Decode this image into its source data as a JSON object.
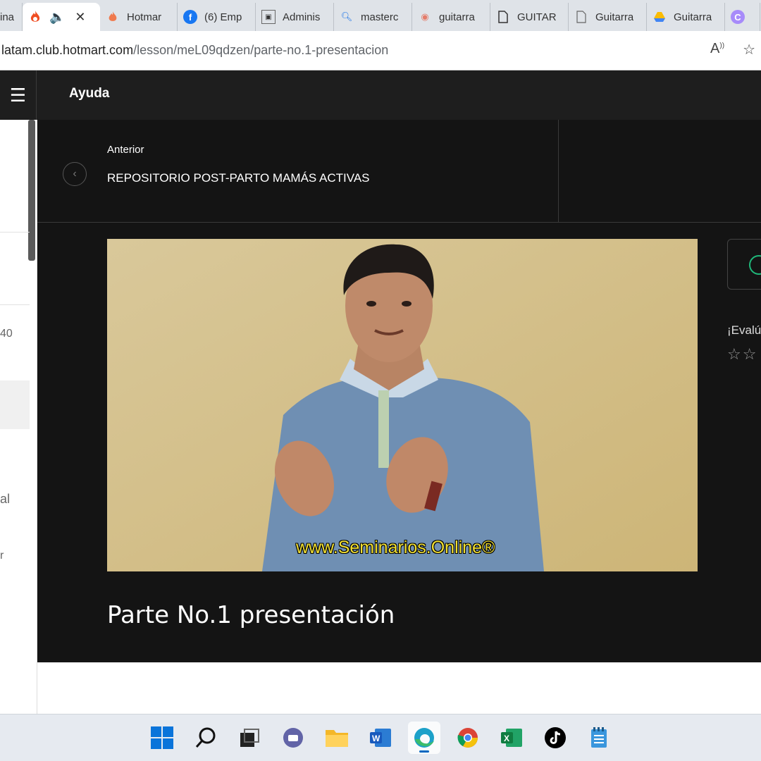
{
  "browser": {
    "tabs": [
      {
        "label": "ina",
        "icon": "page-icon"
      },
      {
        "label": "",
        "icon": "hotmart-flame-icon",
        "active": true
      },
      {
        "label": "Hotmar",
        "icon": "hotmart-flame-icon"
      },
      {
        "label": "(6) Emp",
        "icon": "facebook-icon"
      },
      {
        "label": "Adminis",
        "icon": "admin-icon"
      },
      {
        "label": "masterc",
        "icon": "search-icon"
      },
      {
        "label": "guitarra",
        "icon": "play-icon"
      },
      {
        "label": "GUITAR",
        "icon": "document-icon"
      },
      {
        "label": "Guitarra",
        "icon": "document-icon"
      },
      {
        "label": "Guitarra",
        "icon": "drive-icon"
      },
      {
        "label": "",
        "icon": "c-icon"
      }
    ],
    "url_host": "latam.club.hotmart.com",
    "url_path": "/lesson/meL09qdzen/parte-no.1-presentacion"
  },
  "header": {
    "help_label": "Ayuda"
  },
  "sidebar": {
    "fragments": [
      "40",
      "al",
      "r"
    ]
  },
  "navigation": {
    "prev_label": "Anterior",
    "prev_title": "REPOSITORIO POST-PARTO MAMÁS ACTIVAS"
  },
  "video": {
    "watermark": "www.Seminarios.Online®"
  },
  "lesson": {
    "title": "Parte No.1 presentación"
  },
  "rating": {
    "prompt": "¡Evalú",
    "stars": "☆☆"
  },
  "taskbar": {
    "apps": [
      "windows-start-icon",
      "search-icon",
      "task-view-icon",
      "teams-chat-icon",
      "file-explorer-icon",
      "word-icon",
      "edge-icon",
      "chrome-icon",
      "excel-icon",
      "tiktok-icon",
      "notepad-icon"
    ]
  }
}
